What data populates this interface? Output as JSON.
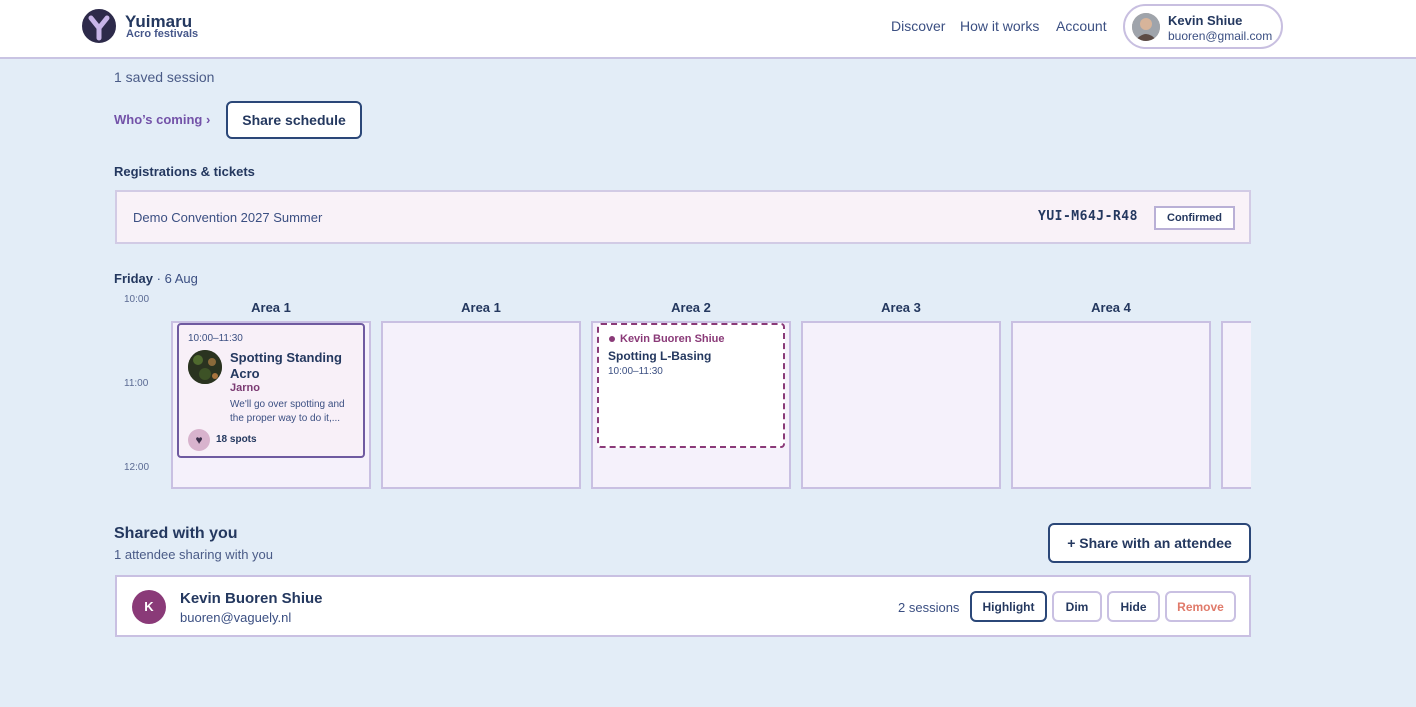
{
  "header": {
    "brand_name": "Yuimaru",
    "brand_sub": "Acro festivals",
    "nav": [
      "Discover",
      "How it works",
      "Account"
    ],
    "user": {
      "name": "Kevin Shiue",
      "email": "buoren@gmail.com"
    }
  },
  "summary": {
    "saved_sessions": "1 saved session",
    "whos_coming": "Who’s coming ›",
    "share_schedule": "Share schedule"
  },
  "registrations": {
    "title": "Registrations & tickets",
    "items": [
      {
        "event": "Demo Convention 2027 Summer",
        "code": "YUI-M64J-R48",
        "status": "Confirmed"
      }
    ]
  },
  "schedule": {
    "day": "Friday",
    "date": "· 6 Aug",
    "times": [
      "10:00",
      "11:00",
      "12:00"
    ],
    "areas": [
      "Area 1",
      "Area 1",
      "Area 2",
      "Area 3",
      "Area 4"
    ],
    "own_session": {
      "time": "10:00–11:30",
      "title": "Spotting Standing Acro",
      "host": "Jarno",
      "description": "We'll go over spotting and the proper way to do it,...",
      "spots": "18 spots"
    },
    "shared_session": {
      "owner": "Kevin Buoren Shiue",
      "title": "Spotting L-Basing",
      "time": "10:00–11:30"
    }
  },
  "shared": {
    "title": "Shared with you",
    "subtitle": "1 attendee sharing with you",
    "share_button": "+ Share with an attendee",
    "attendees": [
      {
        "initial": "K",
        "name": "Kevin Buoren Shiue",
        "email": "buoren@vaguely.nl",
        "sessions": "2 sessions",
        "actions": [
          "Highlight",
          "Dim",
          "Hide",
          "Remove"
        ]
      }
    ]
  },
  "colors": {
    "page_bg": "#e3edf7",
    "accent_purple": "#7352a8",
    "shared_magenta": "#8a3a78",
    "navy": "#24385f",
    "remove_red": "#e07a6a"
  }
}
